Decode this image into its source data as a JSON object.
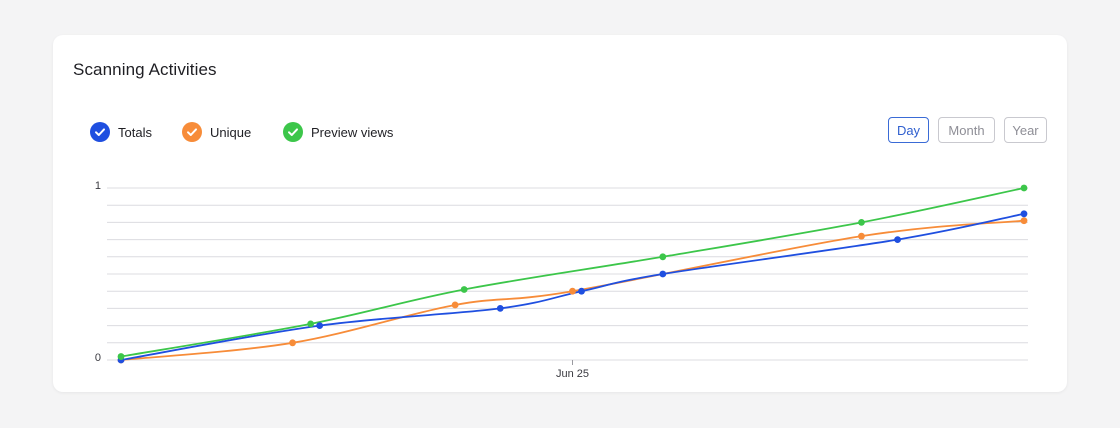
{
  "card": {
    "title": "Scanning Activities"
  },
  "legend": [
    {
      "label": "Totals",
      "color": "#1f4fe0"
    },
    {
      "label": "Unique",
      "color": "#f78c39"
    },
    {
      "label": "Preview views",
      "color": "#3cc64a"
    }
  ],
  "range_buttons": {
    "day": "Day",
    "month": "Month",
    "year": "Year",
    "selected": "Day"
  },
  "chart_data": {
    "type": "line",
    "title": "",
    "xlabel": "",
    "ylabel": "",
    "x_tick_labels": [
      "Jun 25"
    ],
    "y_tick_labels": [
      "1",
      "0"
    ],
    "ylim": [
      0,
      1
    ],
    "grid": true,
    "legend_placement": "top-left",
    "series": [
      {
        "name": "Totals",
        "color": "#1f4fe0",
        "points": [
          [
            0,
            0
          ],
          [
            1.1,
            0.2
          ],
          [
            2.1,
            0.3
          ],
          [
            2.55,
            0.4
          ],
          [
            3.0,
            0.5
          ],
          [
            4.3,
            0.7
          ],
          [
            5.0,
            0.85
          ]
        ]
      },
      {
        "name": "Unique",
        "color": "#f78c39",
        "points": [
          [
            0,
            0
          ],
          [
            0.95,
            0.1
          ],
          [
            1.85,
            0.32
          ],
          [
            2.5,
            0.4
          ],
          [
            4.1,
            0.72
          ],
          [
            5.0,
            0.81
          ]
        ]
      },
      {
        "name": "Preview views",
        "color": "#3cc64a",
        "points": [
          [
            0,
            0.02
          ],
          [
            1.05,
            0.21
          ],
          [
            1.9,
            0.41
          ],
          [
            3.0,
            0.6
          ],
          [
            4.1,
            0.8
          ],
          [
            5.0,
            1.0
          ]
        ]
      }
    ],
    "x_range": [
      0,
      5
    ],
    "x_ticks": [
      [
        2.5,
        "Jun 25"
      ]
    ]
  }
}
